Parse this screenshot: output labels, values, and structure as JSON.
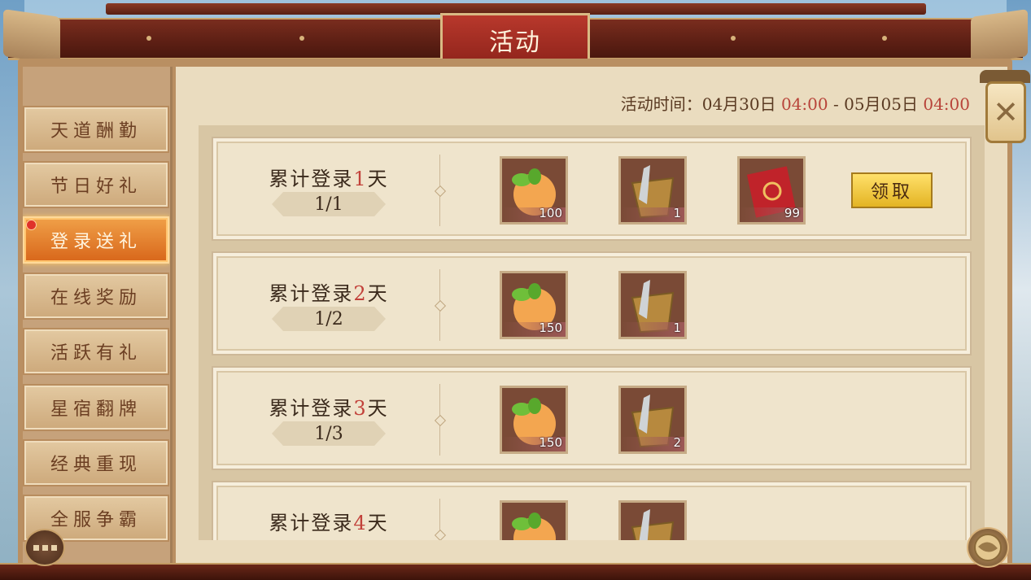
{
  "header": {
    "title": "活动"
  },
  "sidebar": {
    "items": [
      {
        "label": "天道酬勤",
        "active": false
      },
      {
        "label": "节日好礼",
        "active": false
      },
      {
        "label": "登录送礼",
        "active": true
      },
      {
        "label": "在线奖励",
        "active": false
      },
      {
        "label": "活跃有礼",
        "active": false
      },
      {
        "label": "星宿翻牌",
        "active": false
      },
      {
        "label": "经典重现",
        "active": false
      },
      {
        "label": "全服争霸",
        "active": false
      }
    ]
  },
  "event_time": {
    "prefix": "活动时间：04月30日",
    "start_time": "04:00",
    "middle": "- 05月05日",
    "end_time": "04:00"
  },
  "rewards": [
    {
      "title_prefix": "累计登录",
      "day": "1",
      "title_suffix": "天",
      "progress": "1/1",
      "items": [
        {
          "icon": "peach-icon",
          "count": "100"
        },
        {
          "icon": "basket-icon",
          "count": "1"
        },
        {
          "icon": "red-envelope-icon",
          "count": "99"
        }
      ],
      "claim_label": "领取"
    },
    {
      "title_prefix": "累计登录",
      "day": "2",
      "title_suffix": "天",
      "progress": "1/2",
      "items": [
        {
          "icon": "peach-icon",
          "count": "150"
        },
        {
          "icon": "basket-icon",
          "count": "1"
        }
      ]
    },
    {
      "title_prefix": "累计登录",
      "day": "3",
      "title_suffix": "天",
      "progress": "1/3",
      "items": [
        {
          "icon": "peach-icon",
          "count": "150"
        },
        {
          "icon": "basket-icon",
          "count": "2"
        }
      ]
    },
    {
      "title_prefix": "累计登录",
      "day": "4",
      "title_suffix": "天",
      "progress": "",
      "items": [
        {
          "icon": "peach-icon",
          "count": ""
        },
        {
          "icon": "basket-icon",
          "count": ""
        }
      ]
    }
  ],
  "colors": {
    "accent_red": "#c2413a",
    "active_tab": "#e07a24",
    "claim_button": "#f0c83a"
  }
}
